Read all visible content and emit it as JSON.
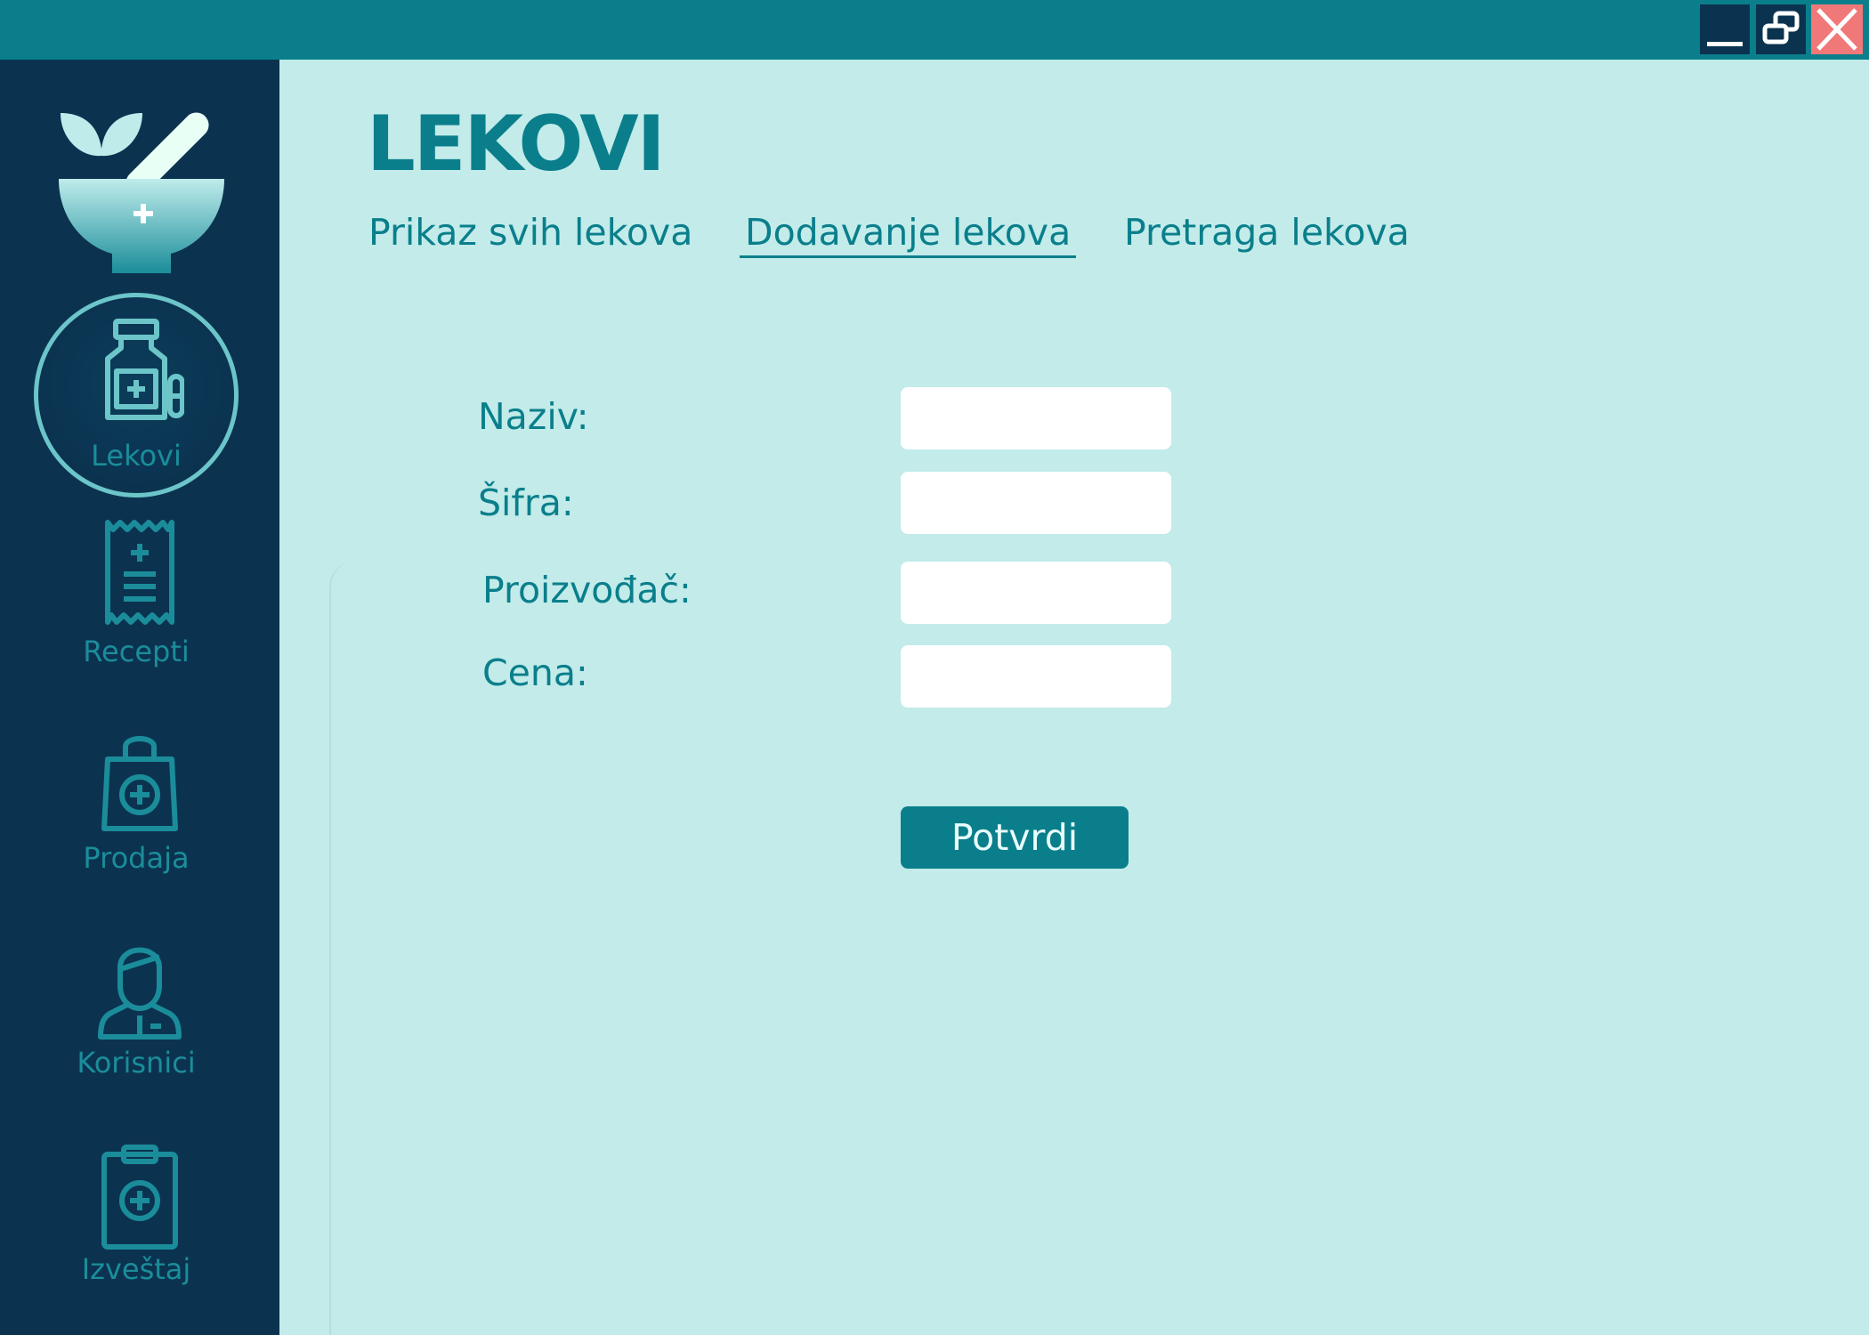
{
  "window_controls": {
    "minimize_icon": "minimize-icon",
    "restore_icon": "restore-icon",
    "close_icon": "close-icon"
  },
  "sidebar": {
    "logo_icon": "mortar-pestle-leaf-icon",
    "items": [
      {
        "label": "Lekovi",
        "icon": "medicine-bottle-icon",
        "active": true
      },
      {
        "label": "Recepti",
        "icon": "prescription-receipt-icon",
        "active": false
      },
      {
        "label": "Prodaja",
        "icon": "shopping-bag-icon",
        "active": false
      },
      {
        "label": "Korisnici",
        "icon": "user-icon",
        "active": false
      },
      {
        "label": "Izveštaj",
        "icon": "clipboard-report-icon",
        "active": false
      }
    ]
  },
  "main": {
    "title": "LEKOVI",
    "tabs": [
      {
        "label": "Prikaz svih lekova",
        "active": false
      },
      {
        "label": "Dodavanje lekova",
        "active": true
      },
      {
        "label": "Pretraga lekova",
        "active": false
      }
    ],
    "form": {
      "fields": [
        {
          "label": "Naziv:",
          "value": ""
        },
        {
          "label": "Šifra:",
          "value": ""
        },
        {
          "label": "Proizvođač:",
          "value": ""
        },
        {
          "label": "Cena:",
          "value": ""
        }
      ],
      "submit_label": "Potvrdi"
    }
  },
  "colors": {
    "teal": "#0a7f8b",
    "navy": "#0b3350",
    "background": "#c2ebea",
    "close": "#f07878"
  }
}
